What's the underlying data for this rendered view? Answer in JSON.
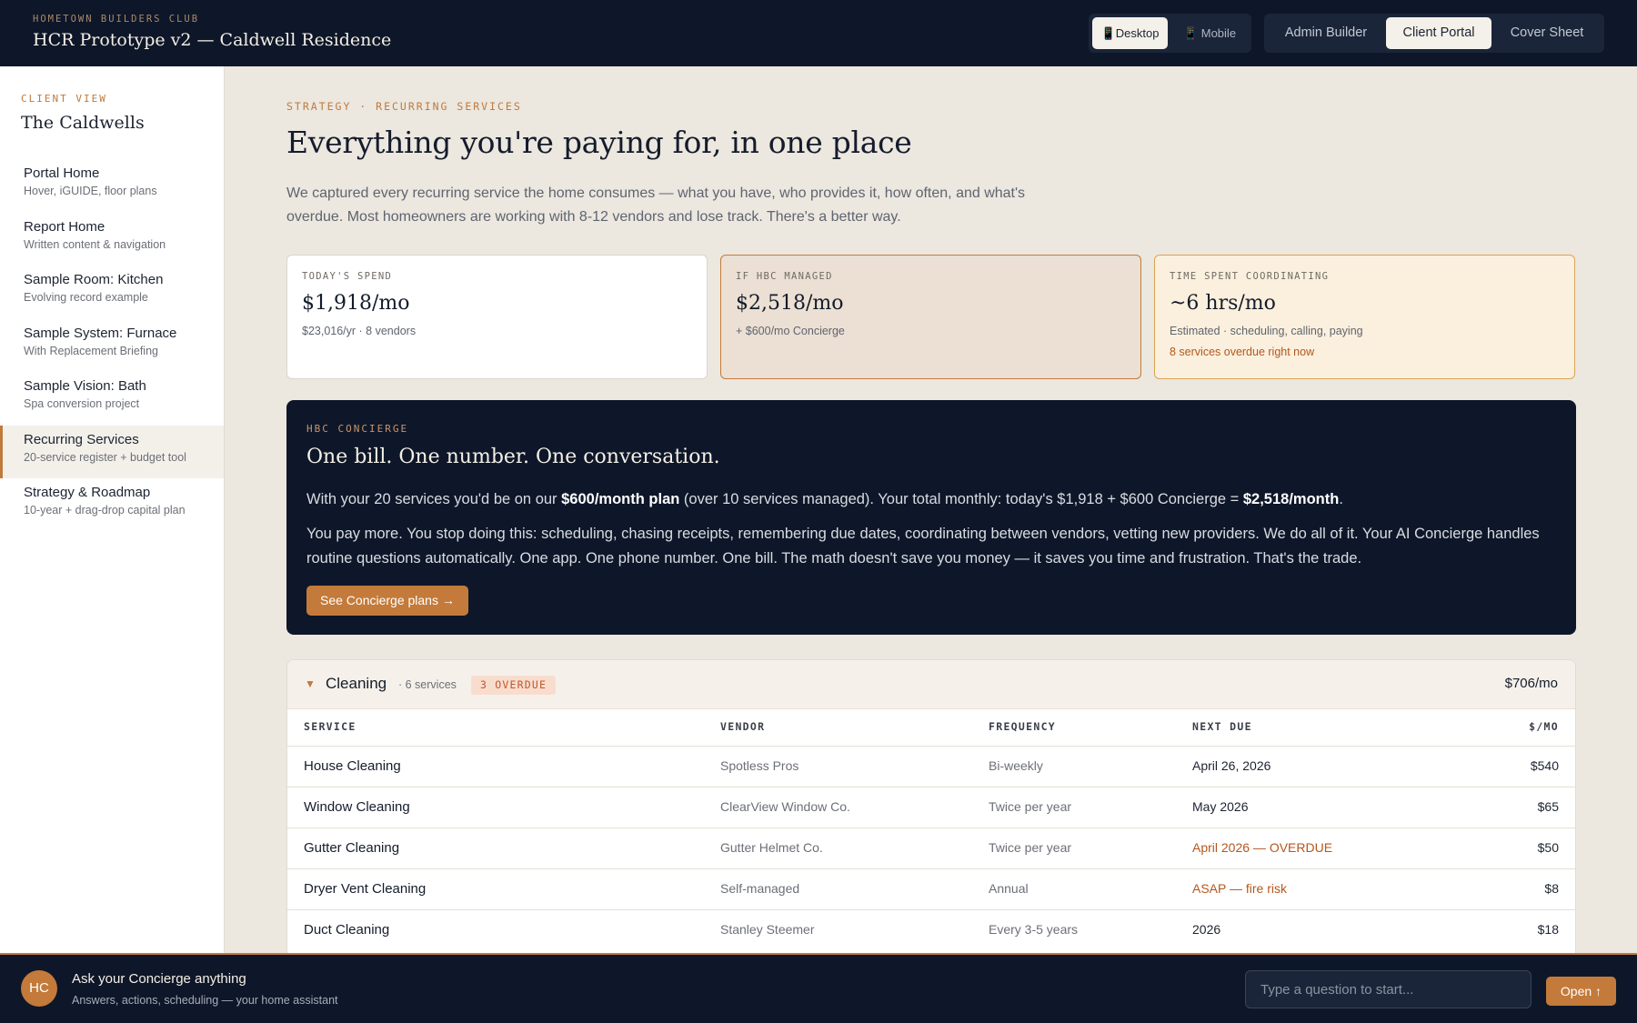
{
  "header": {
    "kicker": "HOMETOWN BUILDERS CLUB",
    "title": "HCR Prototype v2 — Caldwell Residence",
    "device_toggle": [
      {
        "label": "📱Desktop",
        "active": true
      },
      {
        "label": "📱 Mobile",
        "active": false
      }
    ],
    "view_toggle": [
      {
        "label": "Admin Builder",
        "active": false
      },
      {
        "label": "Client Portal",
        "active": true
      },
      {
        "label": "Cover Sheet",
        "active": false
      }
    ]
  },
  "sidebar": {
    "kicker": "CLIENT VIEW",
    "title": "The Caldwells",
    "items": [
      {
        "label": "Portal Home",
        "sub": "Hover, iGUIDE, floor plans",
        "active": false
      },
      {
        "label": "Report Home",
        "sub": "Written content & navigation",
        "active": false
      },
      {
        "label": "Sample Room: Kitchen",
        "sub": "Evolving record example",
        "active": false
      },
      {
        "label": "Sample System: Furnace",
        "sub": "With Replacement Briefing",
        "active": false
      },
      {
        "label": "Sample Vision: Bath",
        "sub": "Spa conversion project",
        "active": false
      },
      {
        "label": "Recurring Services",
        "sub": "20-service register + budget tool",
        "active": true
      },
      {
        "label": "Strategy & Roadmap",
        "sub": "10-year + drag-drop capital plan",
        "active": false
      }
    ]
  },
  "main": {
    "kicker": "STRATEGY · RECURRING SERVICES",
    "headline": "Everything you're paying for, in one place",
    "intro": "We captured every recurring service the home consumes — what you have, who provides it, how often, and what's overdue. Most homeowners are working with 8-12 vendors and lose track. There's a better way.",
    "cards": [
      {
        "kicker": "TODAY'S SPEND",
        "value": "$1,918/mo",
        "sub": "$23,016/yr · 8 vendors",
        "alert": ""
      },
      {
        "kicker": "IF HBC MANAGED",
        "value": "$2,518/mo",
        "sub": "+ $600/mo Concierge",
        "alert": ""
      },
      {
        "kicker": "TIME SPENT COORDINATING",
        "value": "~6 hrs/mo",
        "sub": "Estimated · scheduling, calling, paying",
        "alert": "8 services overdue right now"
      }
    ],
    "concierge": {
      "kicker": "HBC CONCIERGE",
      "title": "One bill. One number. One conversation.",
      "p1_a": "With your 20 services you'd be on our ",
      "p1_b": "$600/month plan",
      "p1_c": " (over 10 services managed). Your total monthly: today's $1,918 + $600 Concierge = ",
      "p1_d": "$2,518/month",
      "p1_e": ".",
      "p2": "You pay more. You stop doing this: scheduling, chasing receipts, remembering due dates, coordinating between vendors, vetting new providers. We do all of it. Your AI Concierge handles routine questions automatically. One app. One phone number. One bill. The math doesn't save you money — it saves you time and frustration. That's the trade.",
      "button": "See Concierge plans →"
    },
    "category": {
      "caret": "▼",
      "name": "Cleaning",
      "count": "· 6 services",
      "badge": "3 OVERDUE",
      "total": "$706/mo",
      "columns": [
        "SERVICE",
        "VENDOR",
        "FREQUENCY",
        "NEXT DUE",
        "$/MO"
      ],
      "rows": [
        {
          "service": "House Cleaning",
          "vendor": "Spotless Pros",
          "frequency": "Bi-weekly",
          "next_due": "April 26, 2026",
          "overdue": false,
          "cost": "$540"
        },
        {
          "service": "Window Cleaning",
          "vendor": "ClearView Window Co.",
          "frequency": "Twice per year",
          "next_due": "May 2026",
          "overdue": false,
          "cost": "$65"
        },
        {
          "service": "Gutter Cleaning",
          "vendor": "Gutter Helmet Co.",
          "frequency": "Twice per year",
          "next_due": "April 2026 — OVERDUE",
          "overdue": true,
          "cost": "$50"
        },
        {
          "service": "Dryer Vent Cleaning",
          "vendor": "Self-managed",
          "frequency": "Annual",
          "next_due": "ASAP — fire risk",
          "overdue": true,
          "cost": "$8"
        },
        {
          "service": "Duct Cleaning",
          "vendor": "Stanley Steemer",
          "frequency": "Every 3-5 years",
          "next_due": "2026",
          "overdue": false,
          "cost": "$18"
        }
      ]
    }
  },
  "bottombar": {
    "avatar": "HC",
    "title": "Ask your Concierge anything",
    "sub": "Answers, actions, scheduling — your home assistant",
    "input_placeholder": "Type a question to start...",
    "button": "Open ↑"
  },
  "colors": {
    "navy": "#0e1729",
    "accent": "#c47a3a",
    "background": "#ece7df",
    "overdue": "#b5561d"
  }
}
